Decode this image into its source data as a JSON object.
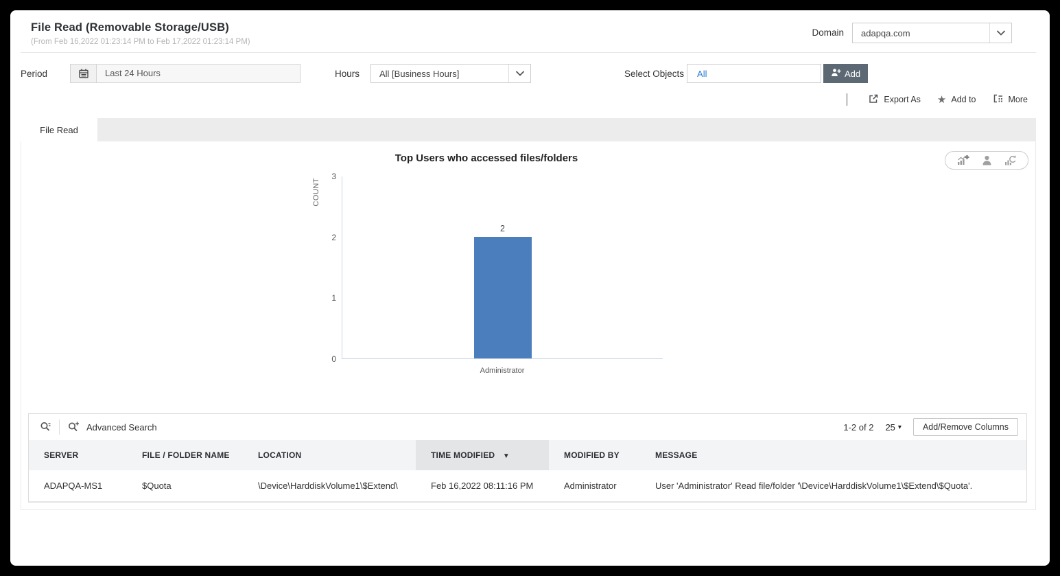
{
  "header": {
    "title": "File Read (Removable Storage/USB)",
    "subtitle": "(From Feb 16,2022 01:23:14 PM to Feb 17,2022 01:23:14 PM)",
    "domain_label": "Domain",
    "domain_value": "adapqa.com"
  },
  "filters": {
    "period_label": "Period",
    "period_value": "Last 24 Hours",
    "hours_label": "Hours",
    "hours_value": "All [Business Hours]",
    "select_objects_label": "Select Objects",
    "select_objects_value": "All",
    "add_button_label": "Add"
  },
  "actions": {
    "export_as": "Export As",
    "add_to": "Add to",
    "more": "More"
  },
  "tabs": [
    {
      "label": "File Read",
      "active": true
    }
  ],
  "chart_data": {
    "type": "bar",
    "title": "Top Users who accessed files/folders",
    "categories": [
      "Administrator"
    ],
    "values": [
      2
    ],
    "xlabel": "",
    "ylabel": "COUNT",
    "ylim": [
      0,
      3
    ],
    "yticks": [
      0,
      1,
      2,
      3
    ],
    "grid": false,
    "legend": false,
    "bar_color": "#4a7ebc"
  },
  "chart_toolbar": {
    "icons": [
      "add-chart-icon",
      "user-view-icon",
      "refresh-chart-icon"
    ]
  },
  "table": {
    "toolbar": {
      "advanced_search_label": "Advanced Search",
      "range_text": "1-2 of 2",
      "page_size": "25",
      "add_remove_columns_label": "Add/Remove Columns"
    },
    "columns": [
      "SERVER",
      "FILE / FOLDER NAME",
      "LOCATION",
      "TIME MODIFIED",
      "MODIFIED BY",
      "MESSAGE"
    ],
    "sorted_column": "TIME MODIFIED",
    "rows": [
      {
        "server": "ADAPQA-MS1",
        "file_folder_name": "$Quota",
        "location": "\\Device\\HarddiskVolume1\\$Extend\\",
        "time_modified": "Feb 16,2022 08:11:16 PM",
        "modified_by": "Administrator",
        "message": "User 'Administrator' Read file/folder '\\Device\\HarddiskVolume1\\$Extend\\$Quota'."
      }
    ]
  },
  "colors": {
    "bar_blue": "#4a7ebc",
    "accent_blue": "#2e7cd0",
    "add_button_bg": "#5c6874"
  }
}
